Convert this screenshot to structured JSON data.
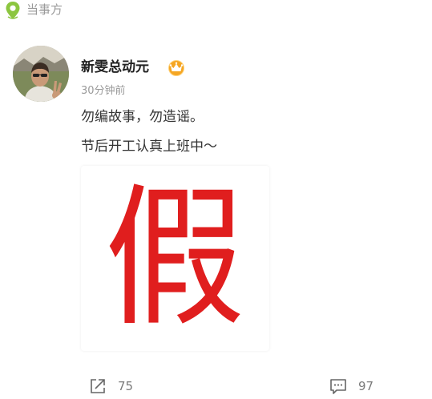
{
  "top": {
    "location_label": "当事方",
    "icon": "location-pin-icon"
  },
  "post": {
    "author_name": "新雯总动元",
    "badge_icon": "vip-crown-icon",
    "timestamp": "30分钟前",
    "text_line_1": "勿编故事，勿造谣。",
    "text_line_2": "节后开工认真上班中～",
    "image_char": "假",
    "image_char_color": "#e01e1e"
  },
  "actions": {
    "share_count": "75",
    "comment_count": "97",
    "share_icon": "share-icon",
    "comment_icon": "comment-icon"
  },
  "colors": {
    "accent_green": "#8cc63f",
    "muted_text": "#9a9a9a",
    "badge_gold": "#f5a623"
  }
}
